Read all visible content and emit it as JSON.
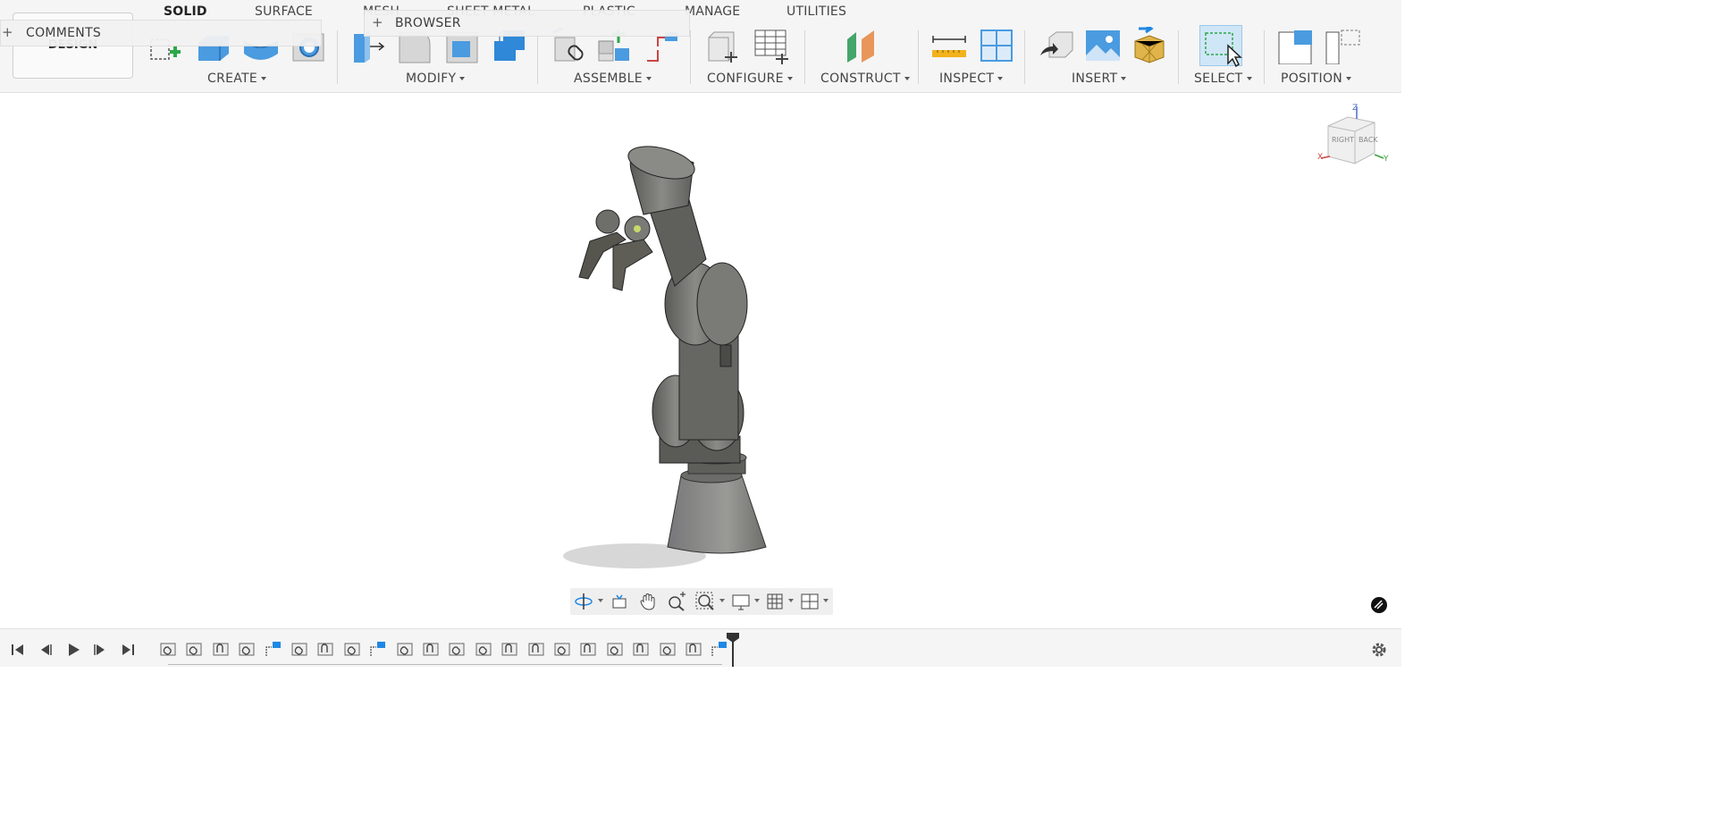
{
  "workspace": {
    "label": "DESIGN"
  },
  "tabs": [
    {
      "label": "SOLID",
      "active": true
    },
    {
      "label": "SURFACE"
    },
    {
      "label": "MESH"
    },
    {
      "label": "SHEET METAL"
    },
    {
      "label": "PLASTIC"
    },
    {
      "label": "MANAGE"
    },
    {
      "label": "UTILITIES"
    }
  ],
  "groups": {
    "create": "CREATE",
    "modify": "MODIFY",
    "assemble": "ASSEMBLE",
    "configure": "CONFIGURE",
    "construct": "CONSTRUCT",
    "inspect": "INSPECT",
    "insert": "INSERT",
    "select": "SELECT",
    "position": "POSITION"
  },
  "panels": {
    "comments": "COMMENTS",
    "browser": "BROWSER"
  },
  "viewcube": {
    "right": "RIGHT",
    "back": "BACK",
    "axis_z": "Z",
    "axis_x": "X",
    "axis_y": "Y"
  },
  "timeline": {
    "feature_count": 22
  },
  "colors": {
    "accent_blue": "#1e88e5",
    "model_gray": "#6b6b68",
    "toolbar_bg": "#f5f5f5"
  }
}
